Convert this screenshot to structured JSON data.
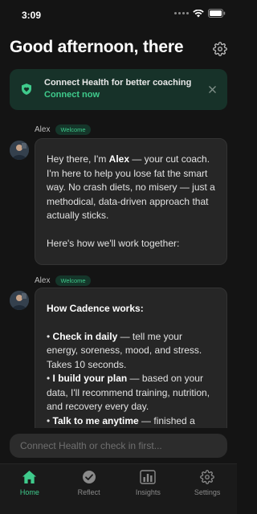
{
  "status": {
    "time": "3:09"
  },
  "header": {
    "title": "Good afternoon, there"
  },
  "banner": {
    "title": "Connect Health for better coaching",
    "link": "Connect now"
  },
  "messages": [
    {
      "sender": "Alex",
      "badge": "Welcome",
      "p1_a": "Hey there, I'm ",
      "p1_b": "Alex",
      "p1_c": " — your cut coach. I'm here to help you lose fat the smart way. No crash diets, no misery — just a methodical, data-driven approach that actually sticks.",
      "p2": "Here's how we'll work together:"
    },
    {
      "sender": "Alex",
      "badge": "Welcome",
      "heading": "How Cadence works:",
      "items": [
        {
          "bold": "Check in daily",
          "text": " — tell me your energy, soreness, mood, and stress. Takes 10 seconds."
        },
        {
          "bold": "I build your plan",
          "text": " — based on your data, I'll recommend training, nutrition, and recovery every day."
        },
        {
          "bold": "Talk to me anytime",
          "text": " — finished a workout? Ask me anything."
        }
      ]
    }
  ],
  "input": {
    "placeholder": "Connect Health or check in first..."
  },
  "tabs": [
    {
      "label": "Home",
      "active": true
    },
    {
      "label": "Reflect",
      "active": false
    },
    {
      "label": "Insights",
      "active": false
    },
    {
      "label": "Settings",
      "active": false
    }
  ],
  "colors": {
    "accent": "#3fcb8c",
    "background": "#141414",
    "banner": "#173229",
    "bubble": "#262626"
  }
}
